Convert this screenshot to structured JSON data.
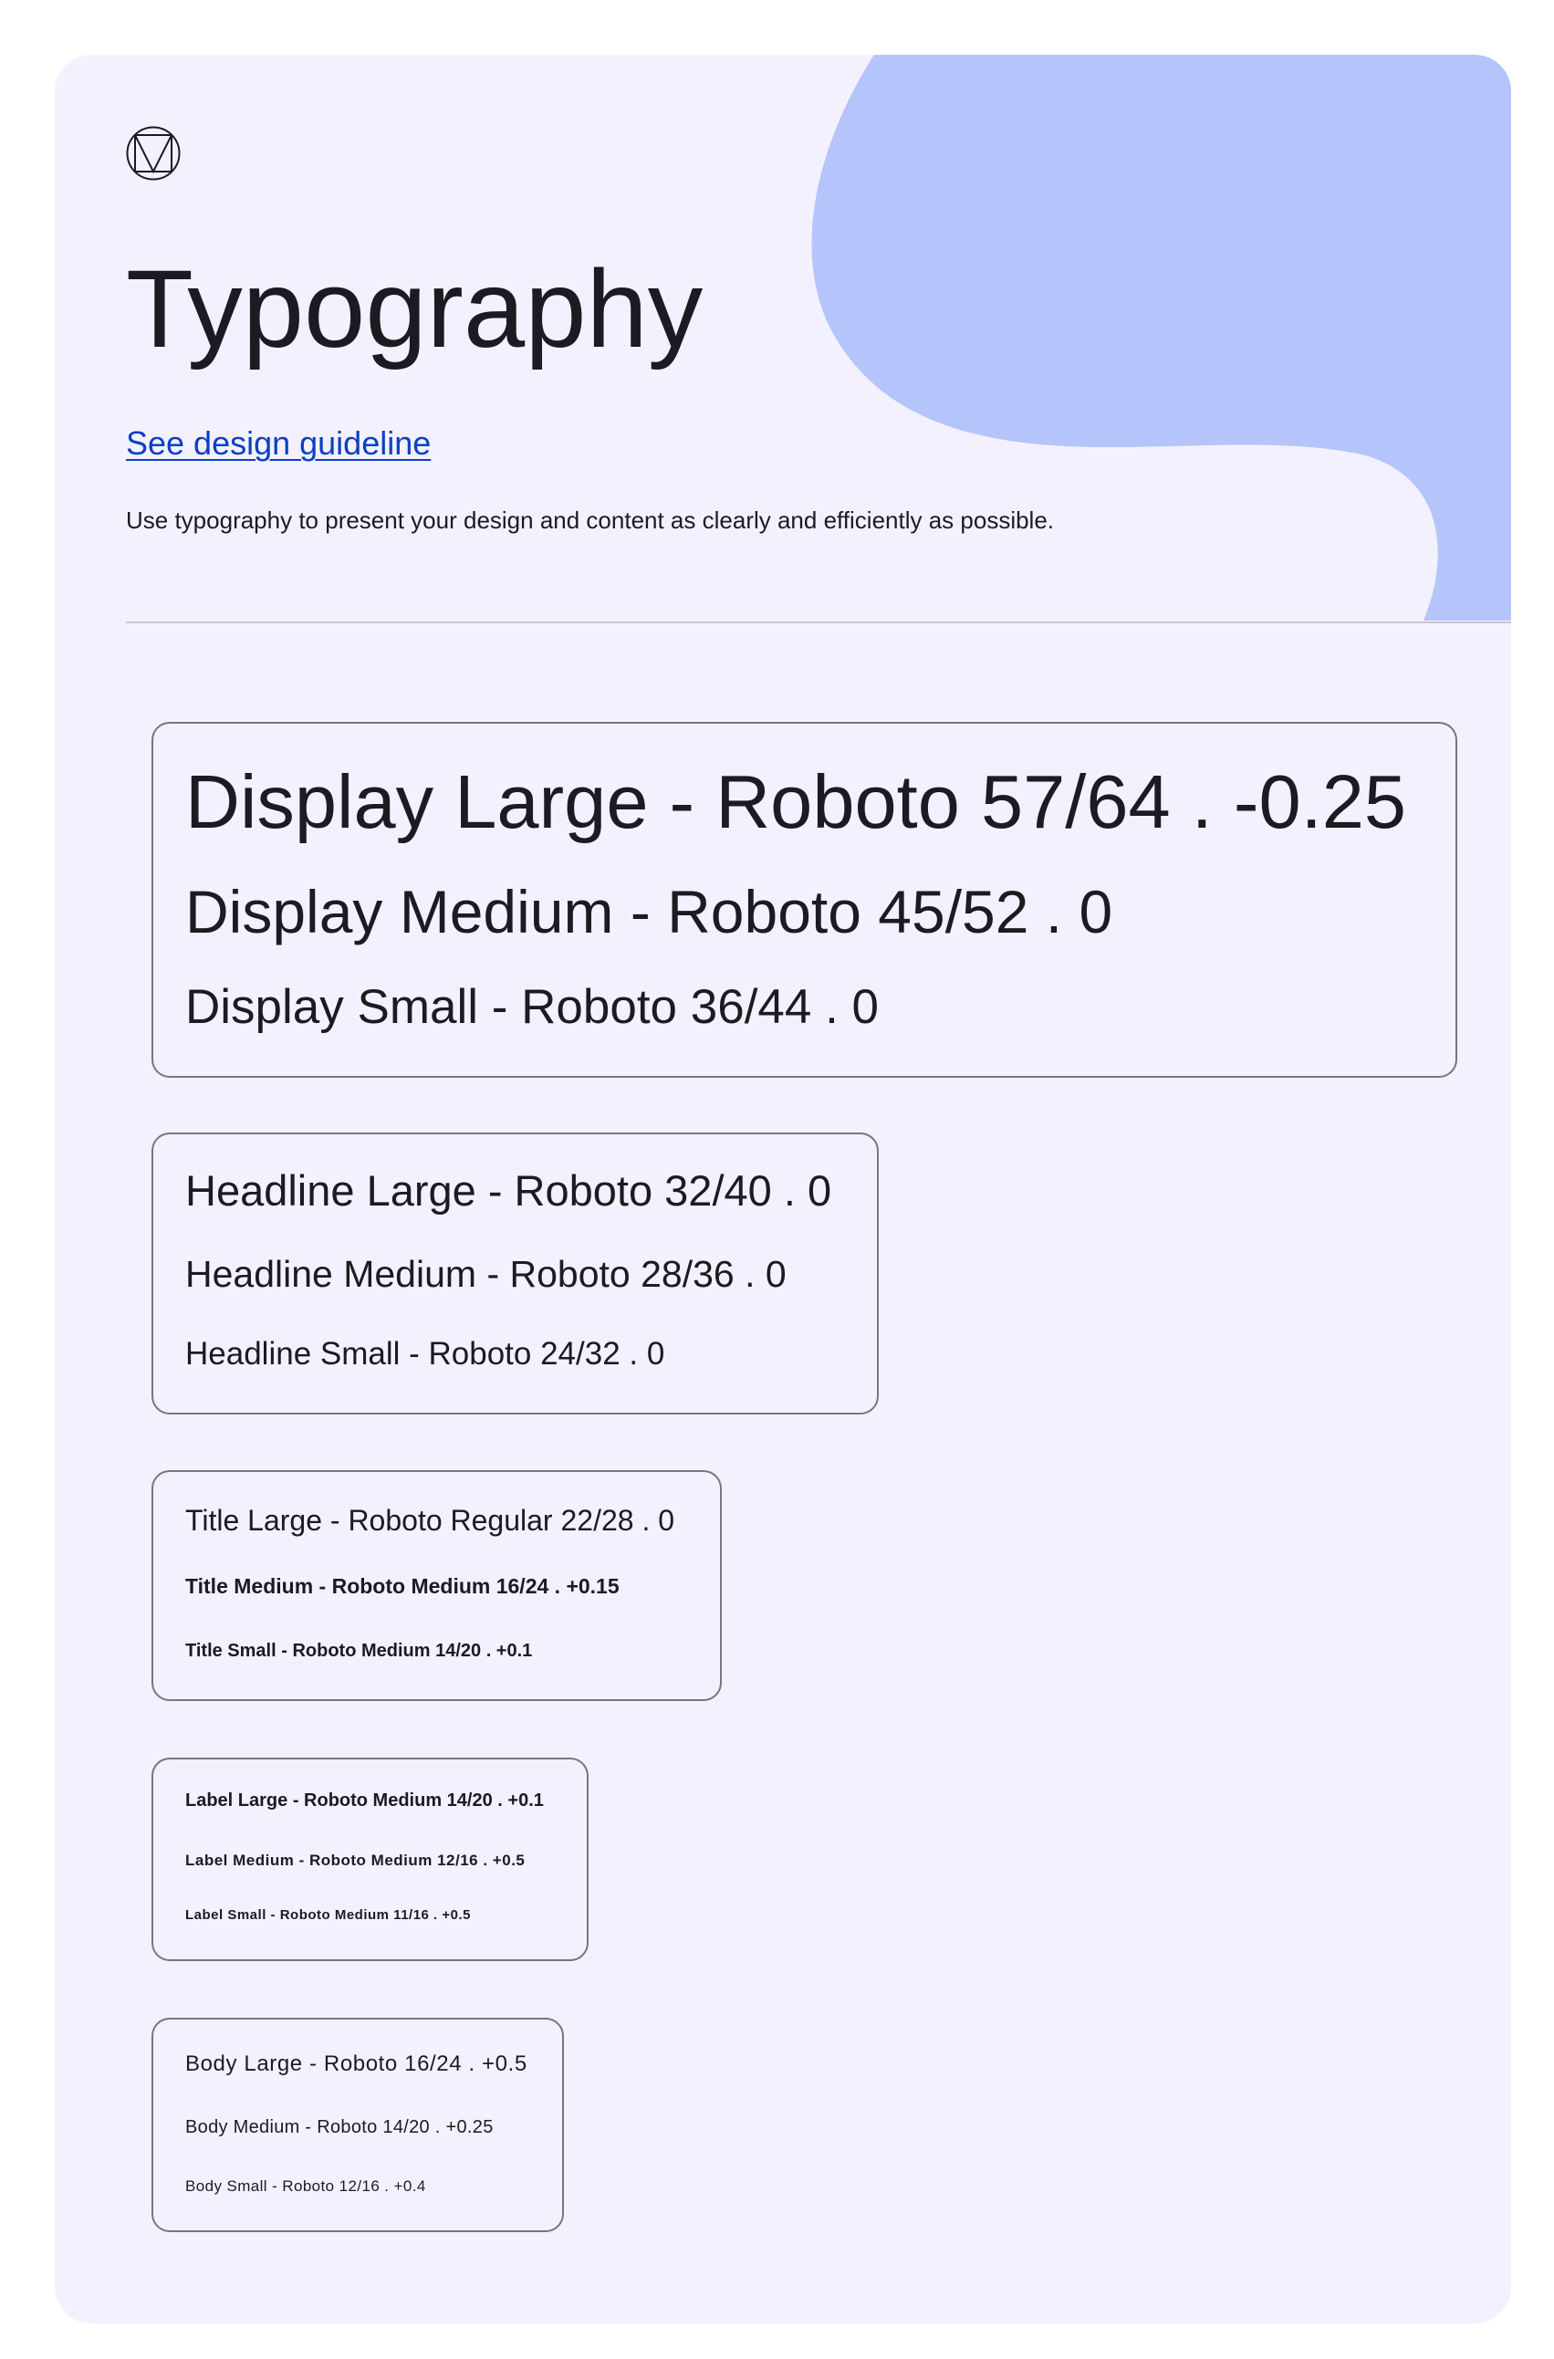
{
  "header": {
    "logo_icon": "material-logo-icon",
    "title": "Typography",
    "link_label": "See design guideline",
    "description": "Use typography to present your design and content as clearly and efficiently as possible."
  },
  "colors": {
    "surface": "#f3f1fd",
    "blob": "#b6c4fc",
    "link": "#0b3fc4",
    "text": "#1b1b21",
    "outline": "#77767f"
  },
  "groups": {
    "display": {
      "large": "Display Large - Roboto 57/64 . -0.25",
      "medium": "Display Medium - Roboto 45/52 . 0",
      "small": "Display Small - Roboto 36/44 . 0"
    },
    "headline": {
      "large": "Headline Large - Roboto 32/40 . 0",
      "medium": "Headline Medium - Roboto 28/36 . 0",
      "small": "Headline Small - Roboto 24/32 . 0"
    },
    "title": {
      "large": "Title Large - Roboto Regular 22/28 . 0",
      "medium": "Title Medium - Roboto Medium 16/24 . +0.15",
      "small": "Title Small - Roboto Medium 14/20 . +0.1"
    },
    "label": {
      "large": "Label Large - Roboto Medium 14/20 . +0.1",
      "medium": "Label Medium - Roboto Medium 12/16 . +0.5",
      "small": "Label Small - Roboto Medium 11/16 . +0.5"
    },
    "body": {
      "large": "Body Large - Roboto 16/24 . +0.5",
      "medium": "Body Medium - Roboto 14/20 . +0.25",
      "small": "Body Small - Roboto 12/16 . +0.4"
    }
  }
}
